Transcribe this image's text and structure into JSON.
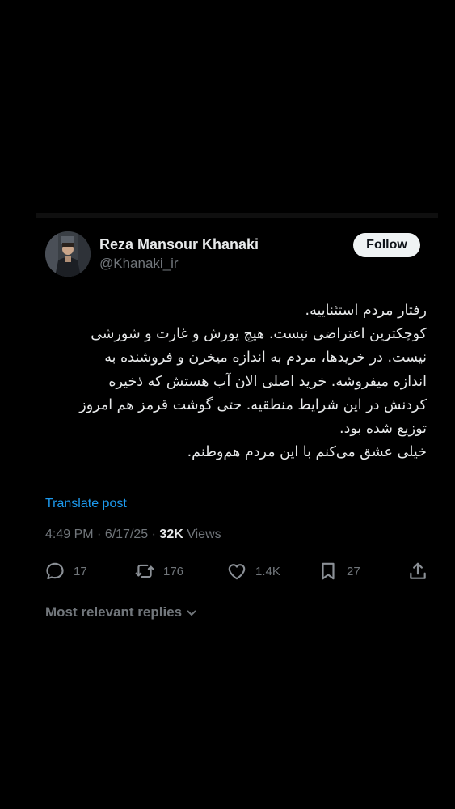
{
  "author": {
    "display_name": "Reza Mansour Khanaki",
    "handle": "@Khanaki_ir"
  },
  "follow_label": "Follow",
  "tweet": {
    "lines": [
      "رفتار مردم استثناییه.",
      "کوچکترین اعتراضی نیست. هیچ یورش و غارت و شورشی",
      "نیست. در خریدها، مردم به اندازه میخرن و فروشنده به",
      "اندازه میفروشه. خرید اصلی الان آب هستش که ذخیره",
      "کردنش در این شرایط منطقیه. حتی گوشت قرمز هم امروز",
      "توزیع شده بود.",
      "خیلی عشق می‌کنم با این مردم هم‌وطنم."
    ]
  },
  "translate_label": "Translate post",
  "meta": {
    "time": "4:49 PM",
    "separator": " · ",
    "date": "6/17/25",
    "views_count": "32K",
    "views_label": " Views"
  },
  "actions": {
    "replies": "17",
    "reposts": "176",
    "likes": "1.4K",
    "bookmarks": "27"
  },
  "replies_sort_label": "Most relevant replies",
  "icons": {
    "reply": "reply-icon",
    "repost": "repost-icon",
    "like": "heart-icon",
    "bookmark": "bookmark-icon",
    "share": "share-icon",
    "sort": "chevron-down-icon"
  },
  "colors": {
    "background": "#000000",
    "text": "#e7e9ea",
    "secondary_text": "#71767b",
    "link": "#1d9bf0",
    "follow_button_bg": "#eff3f4"
  }
}
